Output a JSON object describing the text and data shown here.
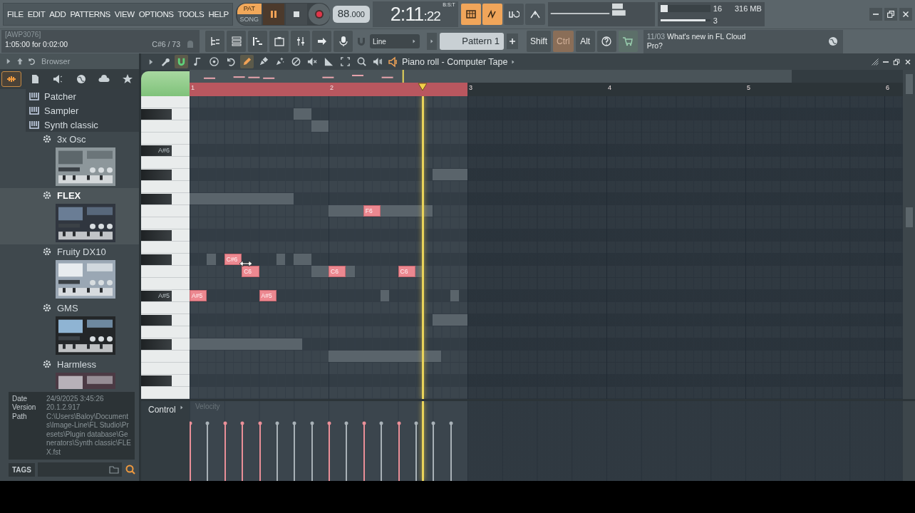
{
  "menu": [
    "FILE",
    "EDIT",
    "ADD",
    "PATTERNS",
    "VIEW",
    "OPTIONS",
    "TOOLS",
    "HELP"
  ],
  "transport": {
    "modes": [
      {
        "label": "PAT",
        "selected": true
      },
      {
        "label": "SONG",
        "selected": false
      }
    ],
    "playing": true
  },
  "tempo": {
    "whole": "88",
    "fraction": ".000"
  },
  "time": {
    "main": "2:11",
    "sub": ":22",
    "format": "B:S:T"
  },
  "monitor": {
    "cpu": "16",
    "memory": "316 MB",
    "polyphony": "3",
    "meters": [
      {
        "level": 0.14
      },
      {
        "level": 0.9
      }
    ]
  },
  "hint": {
    "title": "[AWP3076]",
    "text": "1:05:00 for 0:02:00",
    "note": "C#6 / 73"
  },
  "snap": "Line",
  "pattern": "Pattern 1",
  "modifiers": [
    {
      "label": "Shift",
      "on": false
    },
    {
      "label": "Ctrl",
      "on": true
    },
    {
      "label": "Alt",
      "on": false
    }
  ],
  "news": {
    "date": "11/03",
    "text": "What's new in FL Cloud Pro?"
  },
  "browser": {
    "title": "Browser",
    "tabs": [
      {
        "kind": "plugins",
        "selected": true
      },
      {
        "kind": "files",
        "selected": false
      },
      {
        "kind": "speaker",
        "selected": false
      },
      {
        "kind": "globe",
        "selected": false
      },
      {
        "kind": "cloud",
        "selected": false
      },
      {
        "kind": "star",
        "selected": false
      }
    ],
    "items": [
      {
        "label": "Patcher",
        "kind": "folder"
      },
      {
        "label": "Sampler",
        "kind": "folder"
      },
      {
        "label": "Synth classic",
        "kind": "folder",
        "children": [
          {
            "label": "3x Osc",
            "kind": "plugin",
            "selected": false
          },
          {
            "label": "FLEX",
            "kind": "plugin",
            "selected": true
          },
          {
            "label": "Fruity DX10",
            "kind": "plugin",
            "selected": false
          },
          {
            "label": "GMS",
            "kind": "plugin",
            "selected": false
          },
          {
            "label": "Harmless",
            "kind": "plugin",
            "selected": false
          }
        ]
      }
    ],
    "info": [
      {
        "label": "Date",
        "value": "24/9/2025 3:45:26"
      },
      {
        "label": "Version",
        "value": "20.1.2.917"
      },
      {
        "label": "Path",
        "value": "C:\\Users\\Baloy\\Documents\\Image-Line\\FL Studio\\Presets\\Plugin database\\Generators\\Synth classic\\FLEX.fst"
      }
    ],
    "tags": "TAGS"
  },
  "piano_roll": {
    "title": "Piano roll - Computer Tape",
    "tools": [
      {
        "kind": "wrench",
        "selected": false
      },
      {
        "kind": "magnet",
        "selected": true
      },
      {
        "kind": "note",
        "selected": false
      },
      {
        "kind": "record",
        "selected": false
      },
      {
        "kind": "undo",
        "selected": false
      },
      {
        "kind": "pencil",
        "selected": true
      },
      {
        "kind": "paint",
        "selected": false
      },
      {
        "kind": "burst",
        "selected": false
      },
      {
        "kind": "erase",
        "selected": false
      },
      {
        "kind": "mute",
        "selected": false
      },
      {
        "kind": "slice",
        "selected": false
      },
      {
        "kind": "select",
        "selected": false
      },
      {
        "kind": "zoom",
        "selected": false
      },
      {
        "kind": "play",
        "selected": false
      }
    ],
    "ruler": [
      "1",
      "2",
      "3",
      "4",
      "5",
      "6"
    ],
    "keys": [
      {
        "kind": "white"
      },
      {
        "kind": "black"
      },
      {
        "kind": "white"
      },
      {
        "kind": "white"
      },
      {
        "kind": "black",
        "label": "A#6"
      },
      {
        "kind": "white"
      },
      {
        "kind": "black"
      },
      {
        "kind": "white"
      },
      {
        "kind": "black"
      },
      {
        "kind": "white"
      },
      {
        "kind": "white"
      },
      {
        "kind": "black"
      },
      {
        "kind": "white"
      },
      {
        "kind": "black"
      },
      {
        "kind": "white"
      },
      {
        "kind": "white"
      },
      {
        "kind": "black",
        "label": "A#5"
      },
      {
        "kind": "white"
      },
      {
        "kind": "black"
      },
      {
        "kind": "white"
      },
      {
        "kind": "black"
      },
      {
        "kind": "white"
      },
      {
        "kind": "white"
      },
      {
        "kind": "black"
      },
      {
        "kind": "white"
      }
    ],
    "notes": [
      {
        "label": "A#5"
      },
      {
        "label": "C#6"
      },
      {
        "label": "C6"
      },
      {
        "label": "A#5"
      },
      {
        "label": "C6"
      },
      {
        "label": "F6"
      },
      {
        "label": "C6"
      }
    ],
    "control": {
      "label": "Control",
      "target": "Velocity"
    }
  }
}
